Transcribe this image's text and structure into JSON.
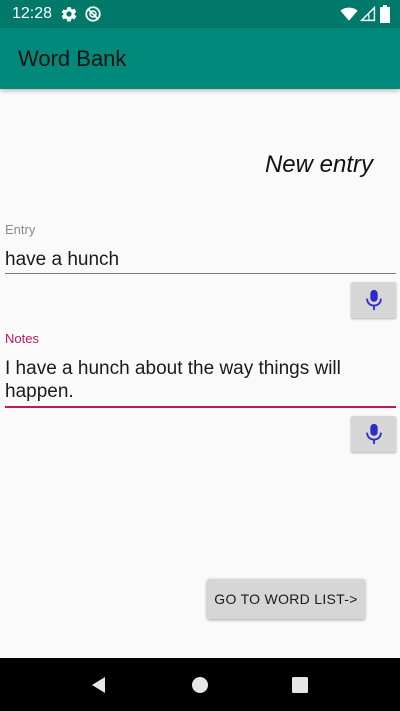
{
  "status_bar": {
    "time": "12:28",
    "icons": [
      "gear-icon",
      "dnd-icon",
      "wifi-icon",
      "signal-icon",
      "battery-icon"
    ]
  },
  "app_bar": {
    "title": "Word Bank",
    "color": "#00897b"
  },
  "form": {
    "heading": "New entry",
    "entry": {
      "label": "Entry",
      "value": "have a hunch"
    },
    "notes": {
      "label": "Notes",
      "value": "I have a hunch about the way things will happen."
    },
    "mic_icon": "microphone-icon",
    "accent_color": "#c2185b"
  },
  "actions": {
    "word_list_button": "GO TO WORD LIST->"
  },
  "nav_bar": {
    "buttons": [
      "back-icon",
      "home-icon",
      "recents-icon"
    ]
  }
}
